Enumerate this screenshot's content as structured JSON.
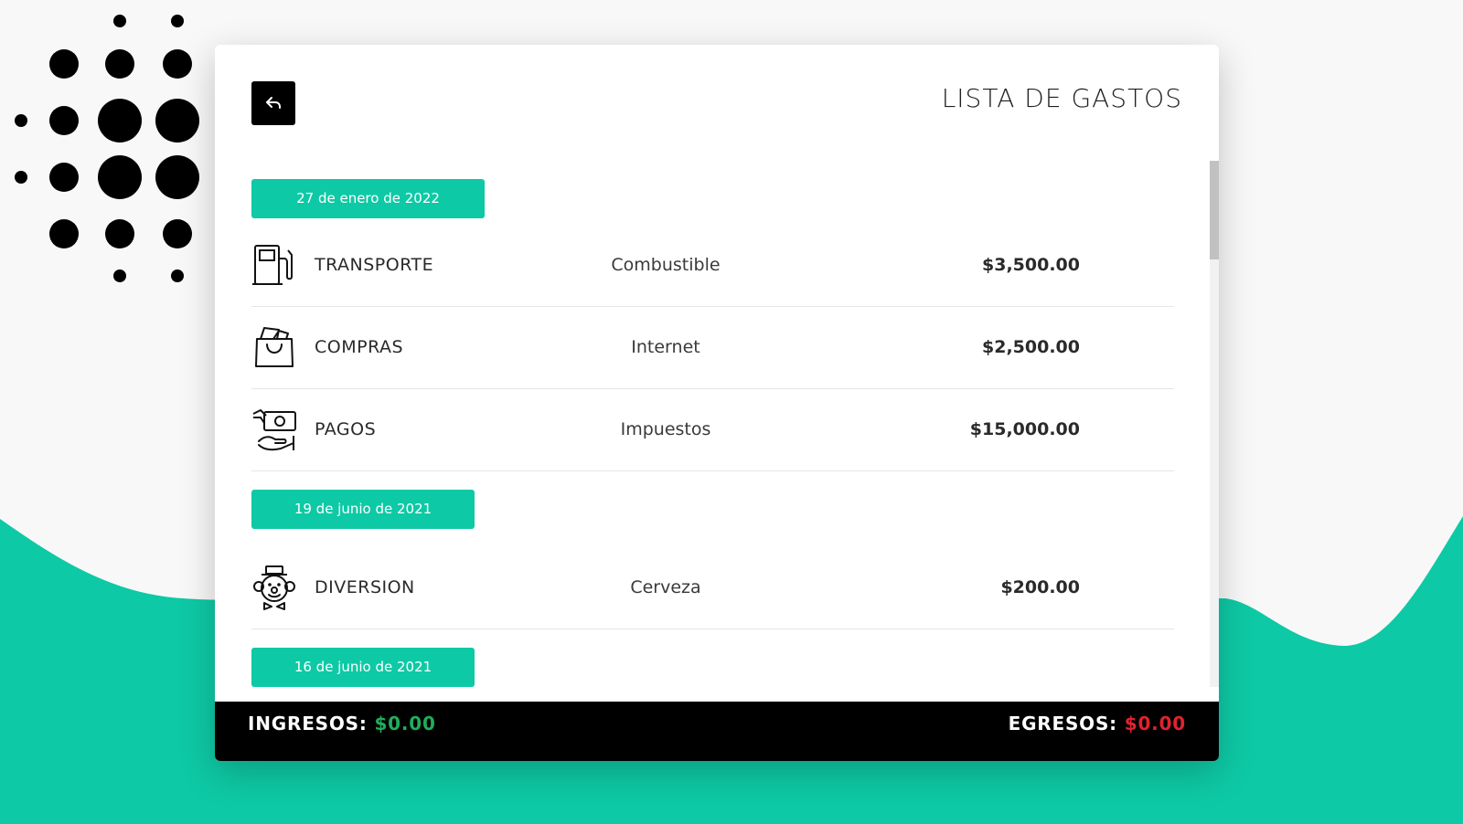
{
  "header": {
    "title": "LISTA DE GASTOS",
    "back_icon": "reply-arrow-icon"
  },
  "groups": [
    {
      "date": "27 de enero de 2022",
      "items": [
        {
          "category": "TRANSPORTE",
          "description": "Combustible",
          "amount": "$3,500.00",
          "icon": "fuel-pump-icon"
        },
        {
          "category": "COMPRAS",
          "description": "Internet",
          "amount": "$2,500.00",
          "icon": "shopping-bag-icon"
        },
        {
          "category": "PAGOS",
          "description": "Impuestos",
          "amount": "$15,000.00",
          "icon": "payment-hand-icon"
        }
      ]
    },
    {
      "date": "19 de junio de 2021",
      "items": [
        {
          "category": "DIVERSION",
          "description": "Cerveza",
          "amount": "$200.00",
          "icon": "clown-icon"
        }
      ]
    },
    {
      "date": "16 de junio de 2021",
      "items": []
    }
  ],
  "footer": {
    "income_label": "INGRESOS:",
    "income_value": "$0.00",
    "expense_label": "EGRESOS:",
    "expense_value": "$0.00"
  },
  "colors": {
    "accent": "#0ec9a5",
    "income": "#1fae5b",
    "expense": "#e0232f",
    "footer_bg": "#000000"
  }
}
